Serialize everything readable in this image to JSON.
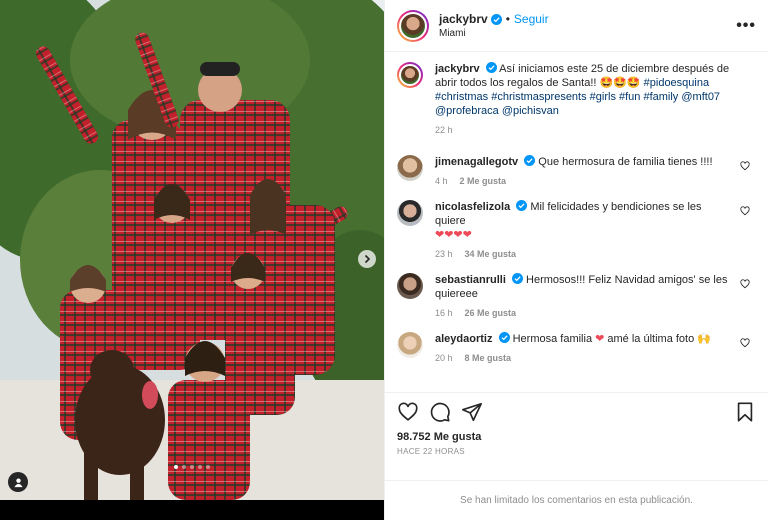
{
  "post": {
    "username": "jackybrv",
    "follow_label": "Seguir",
    "separator": "•",
    "location": "Miami",
    "caption": {
      "text": "Así iniciamos este 25 de diciembre después de abrir todos los regalos de Santa!! 🤩🤩🤩",
      "hashtags": "#pidoesquina #christmas #christmaspresents #girls #fun #family",
      "mention1": "@mft07",
      "mention2": "@profebraca",
      "mention3": "@pichisvan",
      "time": "22 h"
    },
    "likes_total": "98.752 Me gusta",
    "posted_ago": "HACE 22 HORAS",
    "comments_limited": "Se han limitado los comentarios en esta publicación."
  },
  "comments": [
    {
      "username": "jimenagallegotv",
      "text": "Que hermosura de familia tienes !!!!",
      "time": "4 h",
      "likes": "2 Me gusta"
    },
    {
      "username": "nicolasfelizola",
      "text": "Mil felicidades y bendiciones se les quiere",
      "hearts": "❤❤❤❤",
      "time": "23 h",
      "likes": "34 Me gusta"
    },
    {
      "username": "sebastianrulli",
      "text": "Hermosos!!! Feliz Navidad amigos' se les quiereee",
      "time": "16 h",
      "likes": "26 Me gusta"
    },
    {
      "username": "aleydaortiz",
      "text": "Hermosa familia",
      "heart": "❤",
      "text2": "amé la última foto",
      "emoji": "🙌",
      "time": "20 h",
      "likes": "8 Me gusta"
    }
  ],
  "carousel": {
    "count": 5,
    "active_index": 0
  },
  "colors": {
    "follow": "#0095f6",
    "link": "#00376b",
    "heart": "#ed4956",
    "muted": "#8e8e8e",
    "verified": "#0095f6"
  }
}
